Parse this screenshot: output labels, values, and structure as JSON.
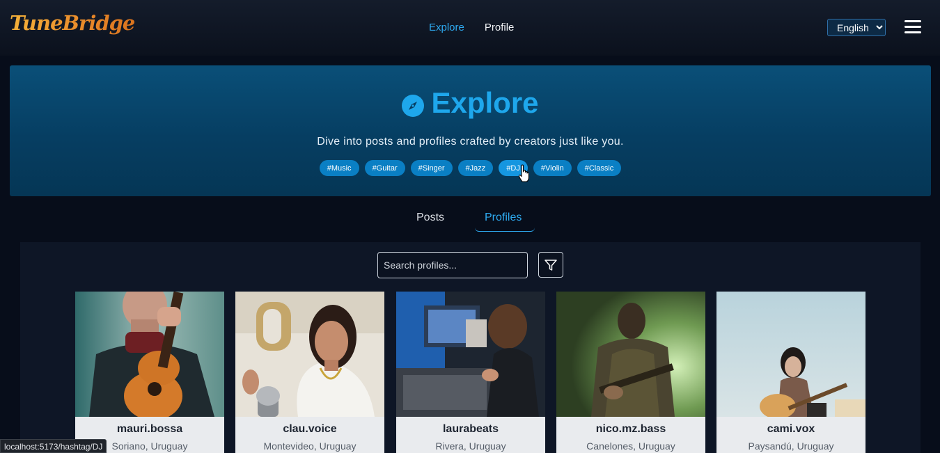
{
  "navbar": {
    "logo": "TuneBridge",
    "links": [
      {
        "label": "Explore",
        "active": true
      },
      {
        "label": "Profile",
        "active": false
      }
    ],
    "language": {
      "selected": "English"
    }
  },
  "hero": {
    "title": "Explore",
    "subtitle": "Dive into posts and profiles crafted by creators just like you.",
    "tags": [
      "#Music",
      "#Guitar",
      "#Singer",
      "#Jazz",
      "#DJ",
      "#Violin",
      "#Classic"
    ]
  },
  "tabs": {
    "posts": "Posts",
    "profiles": "Profiles",
    "active": "profiles"
  },
  "search": {
    "placeholder": "Search profiles..."
  },
  "profiles": [
    {
      "name": "mauri.bossa",
      "location": "Soriano, Uruguay"
    },
    {
      "name": "clau.voice",
      "location": "Montevideo, Uruguay"
    },
    {
      "name": "laurabeats",
      "location": "Rivera, Uruguay"
    },
    {
      "name": "nico.mz.bass",
      "location": "Canelones, Uruguay"
    },
    {
      "name": "cami.vox",
      "location": "Paysandú, Uruguay"
    }
  ],
  "status_bar": {
    "url": "localhost:5173/hashtag/DJ"
  },
  "colors": {
    "accent": "#2eaaf0",
    "tag": "#0a7fc4",
    "hero": "#063e62"
  }
}
